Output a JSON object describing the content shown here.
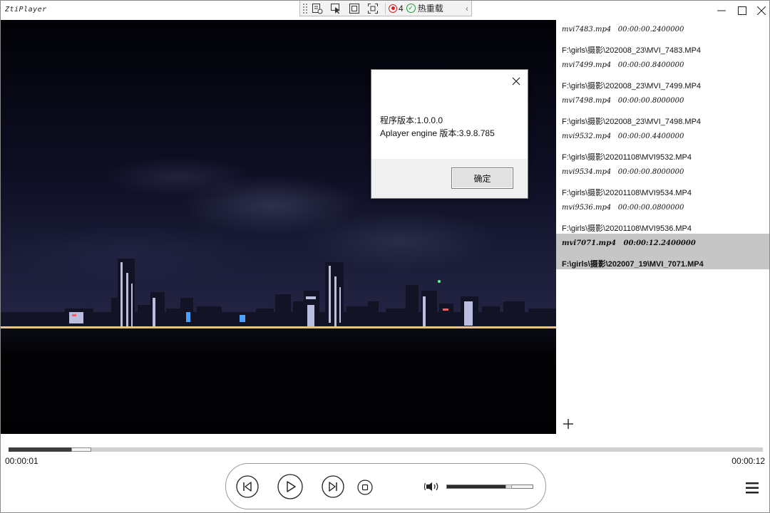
{
  "window": {
    "title": "ZtiPlayer",
    "controls": [
      "minimize-icon",
      "maximize-icon",
      "close-icon"
    ]
  },
  "debug_toolbar": {
    "tools": [
      "live-visual-tree-icon",
      "select-element-icon",
      "display-layout-adorners-icon",
      "track-focused-element-icon"
    ],
    "binding_failures_count": "4",
    "hot_reload_label": "热重载",
    "status_colors": {
      "errors": "#d62020",
      "hot_reload_ok": "#1e9a3a"
    }
  },
  "playlist": {
    "items": [
      {
        "title": "mvi7483.mp4   00:00:00.2400000",
        "path": "F:\\girls\\摄影\\202008_23\\MVI_7483.MP4",
        "selected": false
      },
      {
        "title": "mvi7499.mp4   00:00:00.8400000",
        "path": "F:\\girls\\摄影\\202008_23\\MVI_7499.MP4",
        "selected": false
      },
      {
        "title": "mvi7498.mp4   00:00:00.8000000",
        "path": "F:\\girls\\摄影\\202008_23\\MVI_7498.MP4",
        "selected": false
      },
      {
        "title": "mvi9532.mp4   00:00:00.4400000",
        "path": "F:\\girls\\摄影\\20201108\\MVI9532.MP4",
        "selected": false
      },
      {
        "title": "mvi9534.mp4   00:00:00.8000000",
        "path": "F:\\girls\\摄影\\20201108\\MVI9534.MP4",
        "selected": false
      },
      {
        "title": "mvi9536.mp4   00:00:00.0800000",
        "path": "F:\\girls\\摄影\\20201108\\MVI9536.MP4",
        "selected": false
      },
      {
        "title": "mvi7071.mp4   00:00:12.2400000",
        "path": "F:\\girls\\摄影\\202007_19\\MVI_7071.MP4",
        "selected": true
      }
    ],
    "add_icon": "plus-icon",
    "selected_color": "#c6c6c6"
  },
  "player": {
    "current_time": "00:00:01",
    "total_time": "00:00:12",
    "progress_fraction": 0.083,
    "buffer_fraction": 0.11,
    "volume_fraction": 0.72,
    "buttons": [
      "previous-icon",
      "play-icon",
      "next-icon",
      "stop-icon",
      "volume-icon",
      "menu-icon"
    ]
  },
  "about_dialog": {
    "version_line": "程序版本:1.0.0.0",
    "engine_line": "Aplayer engine 版本:3.9.8.785",
    "ok_label": "确定"
  }
}
